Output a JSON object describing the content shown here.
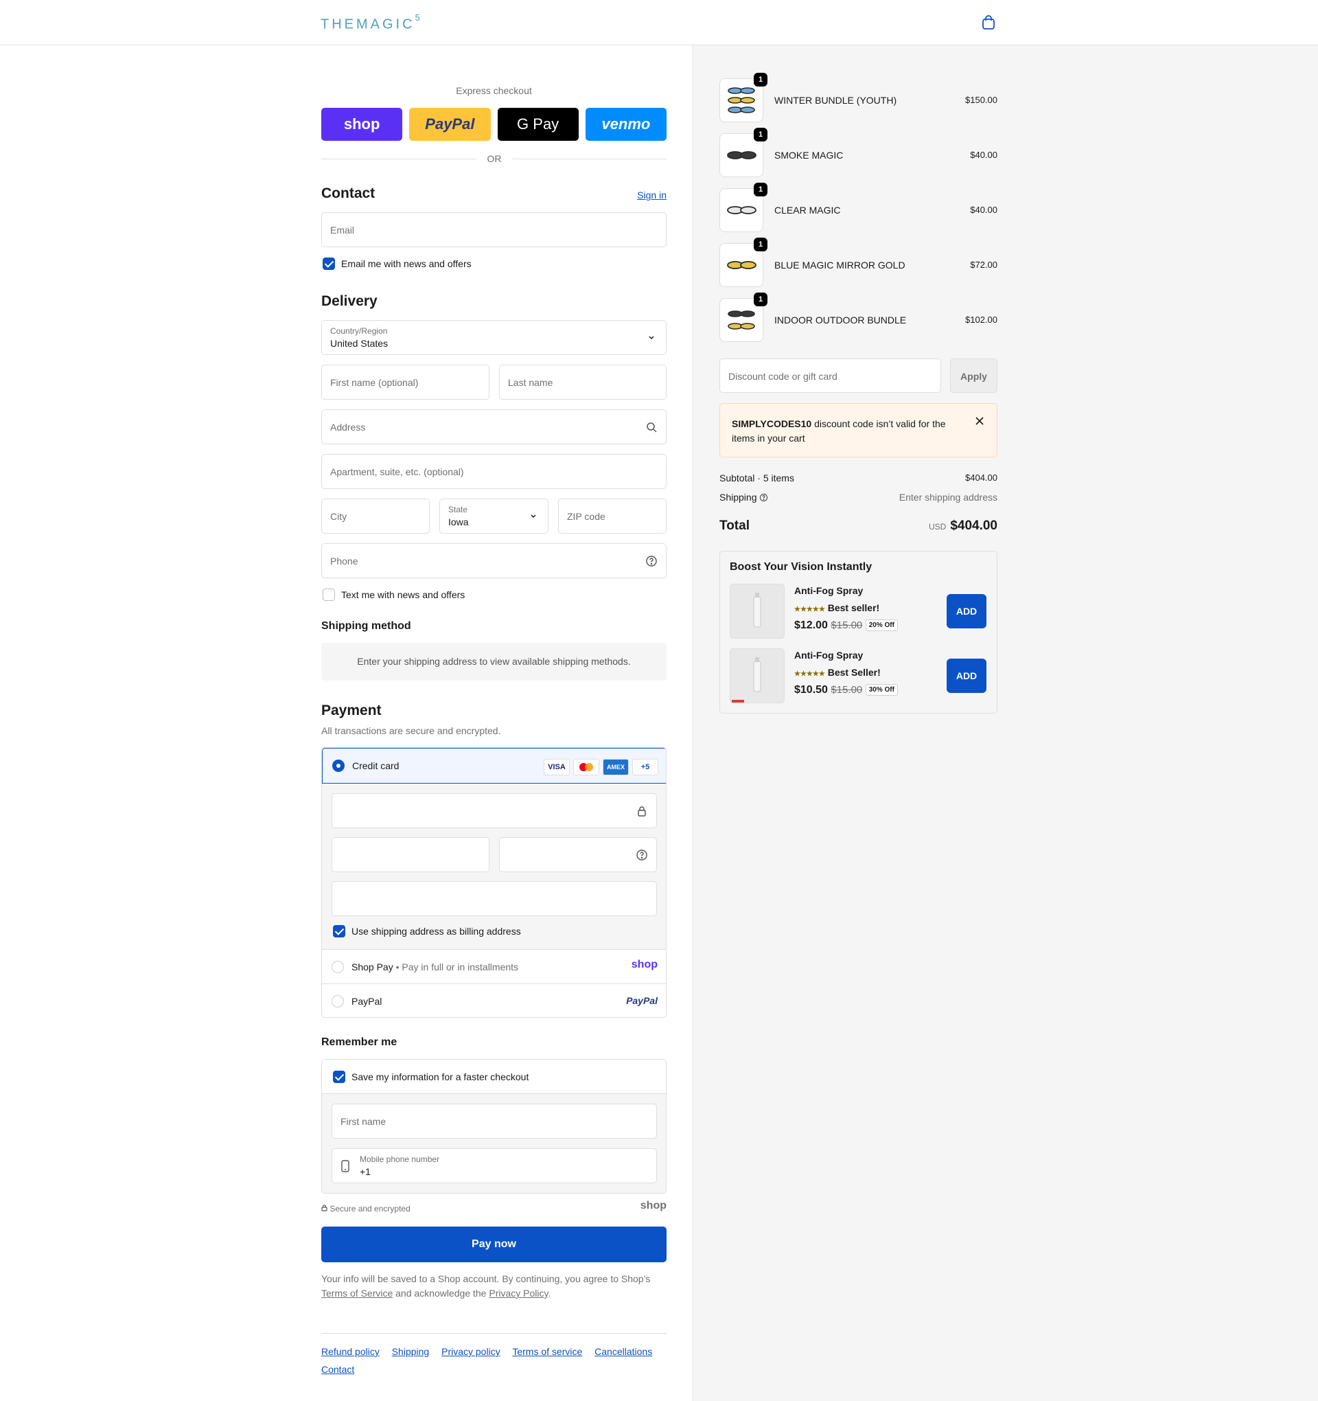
{
  "brand": {
    "logo": "THEMAGIC",
    "logo_sup": "5"
  },
  "express": {
    "title": "Express checkout",
    "buttons": [
      "shop",
      "PayPal",
      "G Pay",
      "venmo"
    ],
    "or": "OR"
  },
  "contact": {
    "heading": "Contact",
    "sign_in": "Sign in",
    "email_placeholder": "Email",
    "news_label": "Email me with news and offers"
  },
  "delivery": {
    "heading": "Delivery",
    "country_label": "Country/Region",
    "country_value": "United States",
    "first_name": "First name (optional)",
    "last_name": "Last name",
    "address": "Address",
    "apartment": "Apartment, suite, etc. (optional)",
    "city": "City",
    "state_label": "State",
    "state_value": "Iowa",
    "zip": "ZIP code",
    "phone": "Phone",
    "text_label": "Text me with news and offers"
  },
  "shipping_method": {
    "heading": "Shipping method",
    "message": "Enter your shipping address to view available shipping methods."
  },
  "payment": {
    "heading": "Payment",
    "subtitle": "All transactions are secure and encrypted.",
    "credit_card": "Credit card",
    "cards": [
      "VISA",
      "MC",
      "AMEX",
      "+5"
    ],
    "billing_label": "Use shipping address as billing address",
    "shop_pay": "Shop Pay",
    "shop_pay_sub": "Pay in full or in installments",
    "shop_logo": "shop",
    "paypal": "PayPal",
    "paypal_logo": "PayPal"
  },
  "remember": {
    "heading": "Remember me",
    "save_label": "Save my information for a faster checkout",
    "first_name": "First name",
    "mobile_label": "Mobile phone number",
    "mobile_value": "+1",
    "secure": "Secure and encrypted",
    "shop_logo": "shop"
  },
  "pay_now": "Pay now",
  "terms": {
    "text1": "Your info will be saved to a Shop account. By continuing, you agree to Shop’s",
    "tos": "Terms of Service",
    "text2": "and acknowledge the",
    "privacy": "Privacy Policy",
    "end": "."
  },
  "footer": [
    "Refund policy",
    "Shipping",
    "Privacy policy",
    "Terms of service",
    "Cancellations",
    "Contact"
  ],
  "cart": {
    "items": [
      {
        "name": "WINTER BUNDLE (YOUTH)",
        "price": "$150.00",
        "qty": "1"
      },
      {
        "name": "SMOKE MAGIC",
        "price": "$40.00",
        "qty": "1"
      },
      {
        "name": "CLEAR MAGIC",
        "price": "$40.00",
        "qty": "1"
      },
      {
        "name": "BLUE MAGIC MIRROR GOLD",
        "price": "$72.00",
        "qty": "1"
      },
      {
        "name": "INDOOR OUTDOOR BUNDLE",
        "price": "$102.00",
        "qty": "1"
      }
    ],
    "discount_placeholder": "Discount code or gift card",
    "apply": "Apply",
    "error_code": "SIMPLYCODES10",
    "error_text": " discount code isn’t valid for the items in your cart",
    "subtotal_label": "Subtotal · 5 items",
    "subtotal_value": "$404.00",
    "shipping_label": "Shipping",
    "shipping_value": "Enter shipping address",
    "total_label": "Total",
    "currency": "USD",
    "total_value": "$404.00"
  },
  "upsell": {
    "heading": "Boost Your Vision Instantly",
    "products": [
      {
        "name": "Anti-Fog Spray",
        "stars": "★★★★★",
        "tag": "Best seller!",
        "price": "$12.00",
        "was": "$15.00",
        "badge": "20% Off",
        "button": "ADD"
      },
      {
        "name": "Anti-Fog Spray",
        "stars": "★★★★★",
        "tag": "Best Seller!",
        "price": "$10.50",
        "was": "$15.00",
        "badge": "30% Off",
        "button": "ADD"
      }
    ]
  }
}
